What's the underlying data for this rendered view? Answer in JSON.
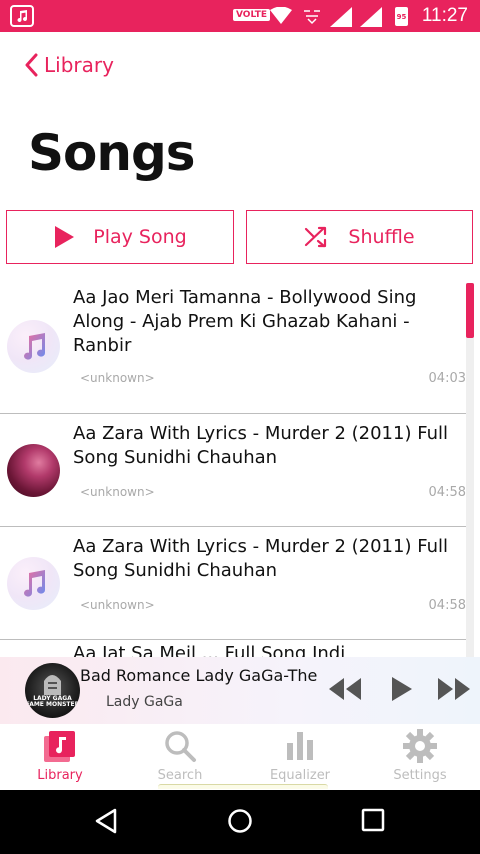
{
  "status_bar": {
    "volte": "VOLTE",
    "battery": "95",
    "time": "11:27"
  },
  "header": {
    "back_label": "Library",
    "title": "Songs"
  },
  "actions": {
    "play_label": "Play Song",
    "shuffle_label": "Shuffle"
  },
  "songs": [
    {
      "title": "Aa Jao Meri Tamanna - Bollywood Sing Along - Ajab Prem Ki Ghazab Kahani - Ranbir",
      "artist": "<unknown>",
      "duration": "04:03",
      "art": "music-note-icon"
    },
    {
      "title": "Aa Zara With Lyrics - Murder 2 (2011) Full Song Sunidhi Chauhan",
      "artist": "<unknown>",
      "duration": "04:58",
      "art": "album-photo"
    },
    {
      "title": "Aa Zara With Lyrics - Murder 2 (2011) Full Song Sunidhi Chauhan",
      "artist": "<unknown>",
      "duration": "04:58",
      "art": "music-note-icon"
    }
  ],
  "peek_row": "Aa Jat Sa Meil ... Full Song Indi",
  "now_playing": {
    "title": "Bad Romance Lady GaGa-The Fame",
    "artist": "Lady GaGa",
    "cover_text": "LADY GAGA FAME MONSTER"
  },
  "tabs": [
    {
      "label": "Library",
      "icon": "library-icon",
      "active": true
    },
    {
      "label": "Search",
      "icon": "search-icon",
      "active": false
    },
    {
      "label": "Equalizer",
      "icon": "equalizer-icon",
      "active": false
    },
    {
      "label": "Settings",
      "icon": "gear-icon",
      "active": false
    }
  ],
  "colors": {
    "accent": "#e8235d",
    "inactive_tab": "#bdbdbd",
    "muted_text": "#a9a9a9"
  }
}
